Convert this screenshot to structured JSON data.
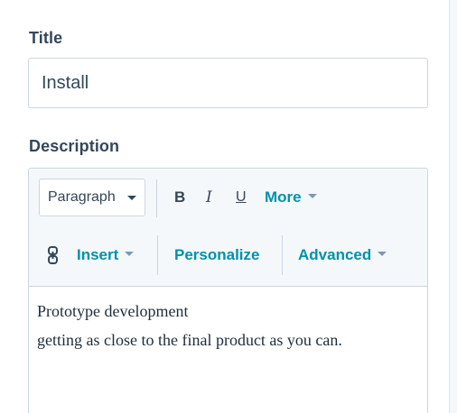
{
  "title_field": {
    "label": "Title",
    "value": "Install"
  },
  "description_field": {
    "label": "Description",
    "toolbar": {
      "block_format": "Paragraph",
      "bold": "B",
      "italic": "I",
      "underline": "U",
      "more": "More",
      "insert": "Insert",
      "personalize": "Personalize",
      "advanced": "Advanced"
    },
    "content_lines": [
      "Prototype development",
      "getting as close to the final product as you can."
    ]
  },
  "colors": {
    "label_text": "#33475b",
    "accent_teal": "#0091ae",
    "border": "#cbd6e2",
    "toolbar_bg": "#f5f8fa"
  },
  "icons": {
    "link": "link-icon",
    "dropdown": "chevron-down-icon"
  }
}
